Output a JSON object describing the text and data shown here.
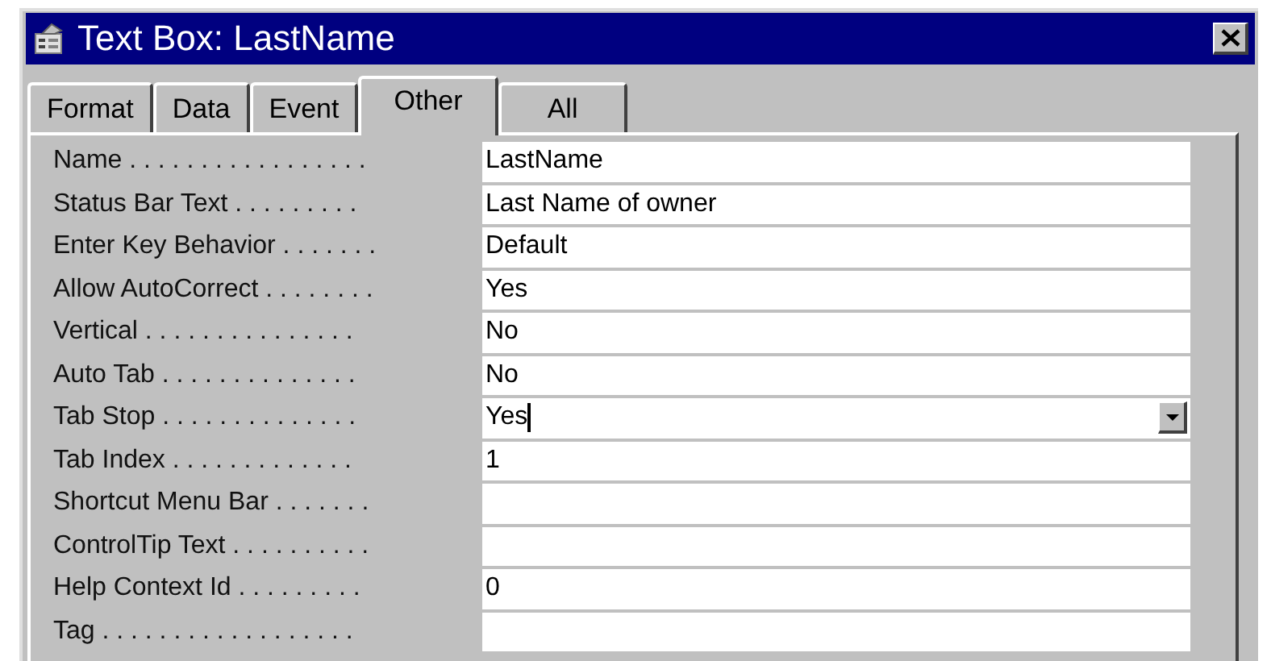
{
  "window": {
    "title": "Text Box: LastName"
  },
  "tabs": [
    {
      "label": "Format",
      "selected": false
    },
    {
      "label": "Data",
      "selected": false
    },
    {
      "label": "Event",
      "selected": false
    },
    {
      "label": "Other",
      "selected": true
    },
    {
      "label": "All",
      "selected": false
    }
  ],
  "properties": [
    {
      "label": "Name . . . . . . . . . . . . . . . . .",
      "value": "LastName",
      "focused": false
    },
    {
      "label": "Status Bar Text . . . . . . . . .",
      "value": "Last Name of owner",
      "focused": false
    },
    {
      "label": "Enter Key Behavior . . . . . . .",
      "value": "Default",
      "focused": false
    },
    {
      "label": "Allow AutoCorrect . . . . . . . .",
      "value": "Yes",
      "focused": false
    },
    {
      "label": "Vertical . . . . . . . . . . . . . . .",
      "value": "No",
      "focused": false
    },
    {
      "label": "Auto Tab . . . . . . . . . . . . . .",
      "value": "No",
      "focused": false
    },
    {
      "label": "Tab Stop . . . . . . . . . . . . . .",
      "value": "Yes",
      "focused": true
    },
    {
      "label": "Tab Index . . . . . . . . . . . . .",
      "value": "1",
      "focused": false
    },
    {
      "label": "Shortcut Menu Bar . . . . . . .",
      "focused": false
    },
    {
      "label": "ControlTip Text . . . . . . . . . .",
      "focused": false
    },
    {
      "label": "Help Context Id . . . . . . . . .",
      "value": "0",
      "focused": false
    },
    {
      "label": "Tag . . . . . . . . . . . . . . . . . .",
      "focused": false
    }
  ]
}
